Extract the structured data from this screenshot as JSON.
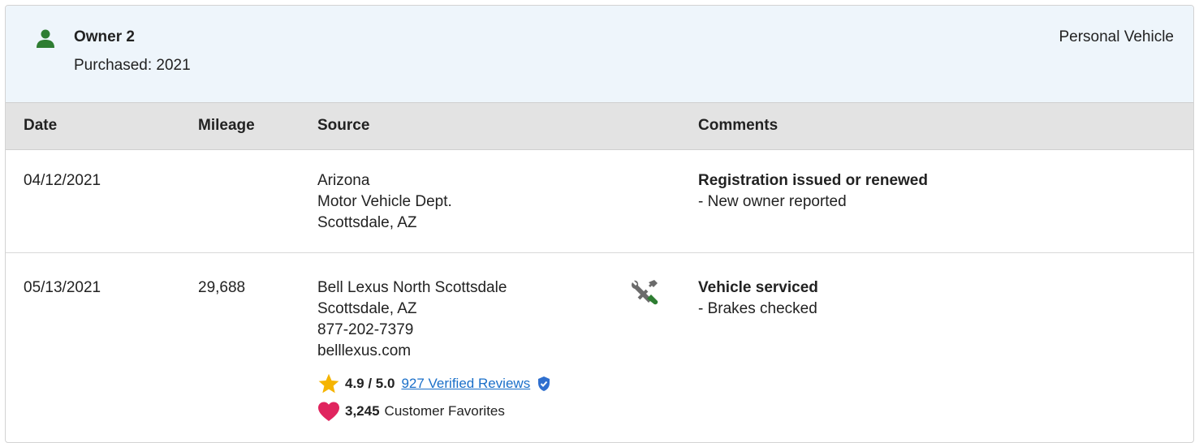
{
  "owner": {
    "title": "Owner 2",
    "purchased": "Purchased: 2021",
    "vehicle_type": "Personal Vehicle",
    "icon": "person-icon",
    "icon_color": "#2e7d32"
  },
  "table": {
    "headers": {
      "date": "Date",
      "mileage": "Mileage",
      "source": "Source",
      "comments": "Comments"
    },
    "rows": [
      {
        "date": "04/12/2021",
        "mileage": "",
        "source": [
          "Arizona",
          "Motor Vehicle Dept.",
          "Scottsdale, AZ"
        ],
        "comment_title": "Registration issued or renewed",
        "comment_detail": "- New owner reported"
      },
      {
        "date": "05/13/2021",
        "mileage": "29,688",
        "source": [
          "Bell Lexus North Scottsdale",
          "Scottsdale, AZ",
          "877-202-7379",
          "belllexus.com"
        ],
        "icon": "wrench-screwdriver-icon",
        "comment_title": "Vehicle serviced",
        "comment_detail": "- Brakes checked",
        "rating": {
          "value": "4.9 / 5.0",
          "reviews_link": "927 Verified Reviews",
          "star_color": "#f5b400",
          "link_color": "#1a6fc9",
          "verified_icon": "verified-shield-icon"
        },
        "favorites": {
          "count": "3,245",
          "label": "Customer Favorites",
          "heart_color": "#e0245e"
        }
      }
    ]
  },
  "colors": {
    "header_bg": "#eef5fb",
    "table_header_bg": "#e3e3e3"
  }
}
